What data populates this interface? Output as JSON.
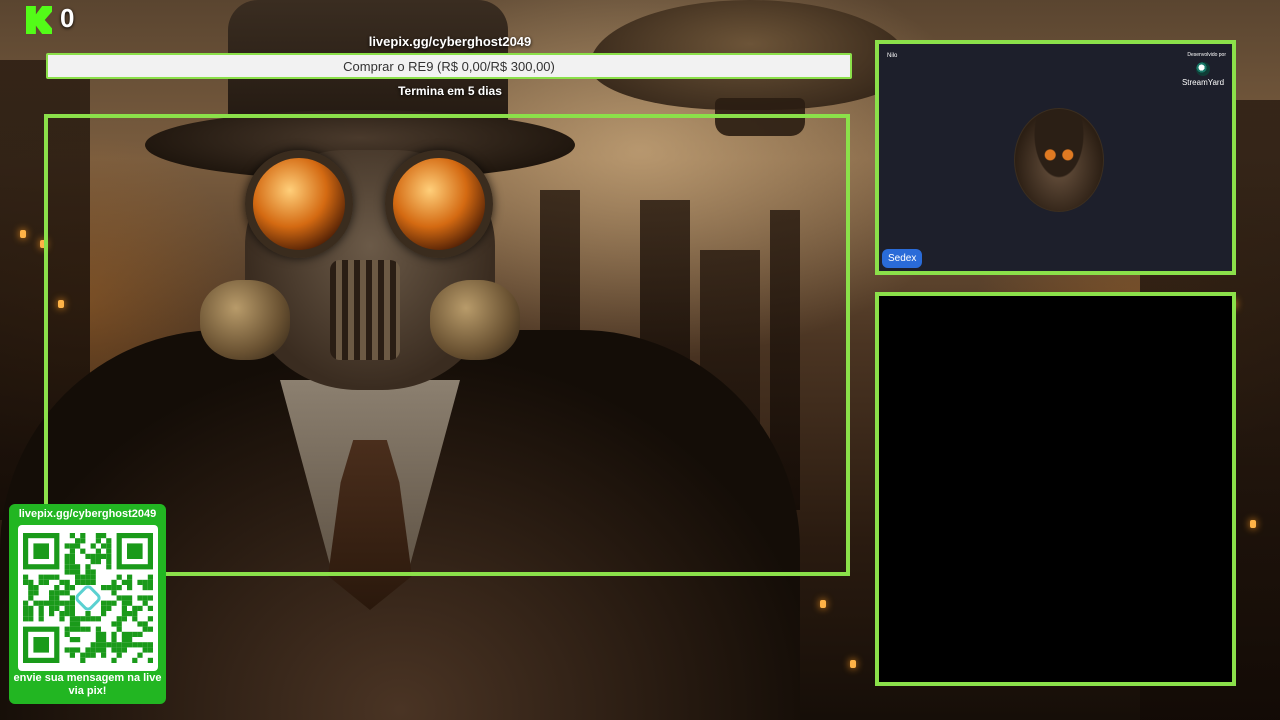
{
  "kick": {
    "logo_icon": "kick-logo-icon",
    "count": "0"
  },
  "goal": {
    "url": "livepix.gg/cyberghost2049",
    "label": "Comprar o RE9 (R$ 0,00/R$ 300,00)",
    "progress_fraction": 0,
    "ends": "Termina em 5 dias",
    "bar_fill_color": "#53fc18"
  },
  "camera": {
    "title": "Nilo",
    "powered_by": "Desenvolvido por",
    "brand": "StreamYard",
    "participant_name": "Sedex"
  },
  "pix_panel": {
    "url": "livepix.gg/cyberghost2049",
    "message": "envie sua mensagem na live via pix!"
  },
  "colors": {
    "frame_border": "#8be04a",
    "pix_panel_bg": "#22b622",
    "name_tag_bg": "#2a6bd8",
    "cam_bg": "#1d1f2b",
    "chat_bg": "#000000"
  }
}
